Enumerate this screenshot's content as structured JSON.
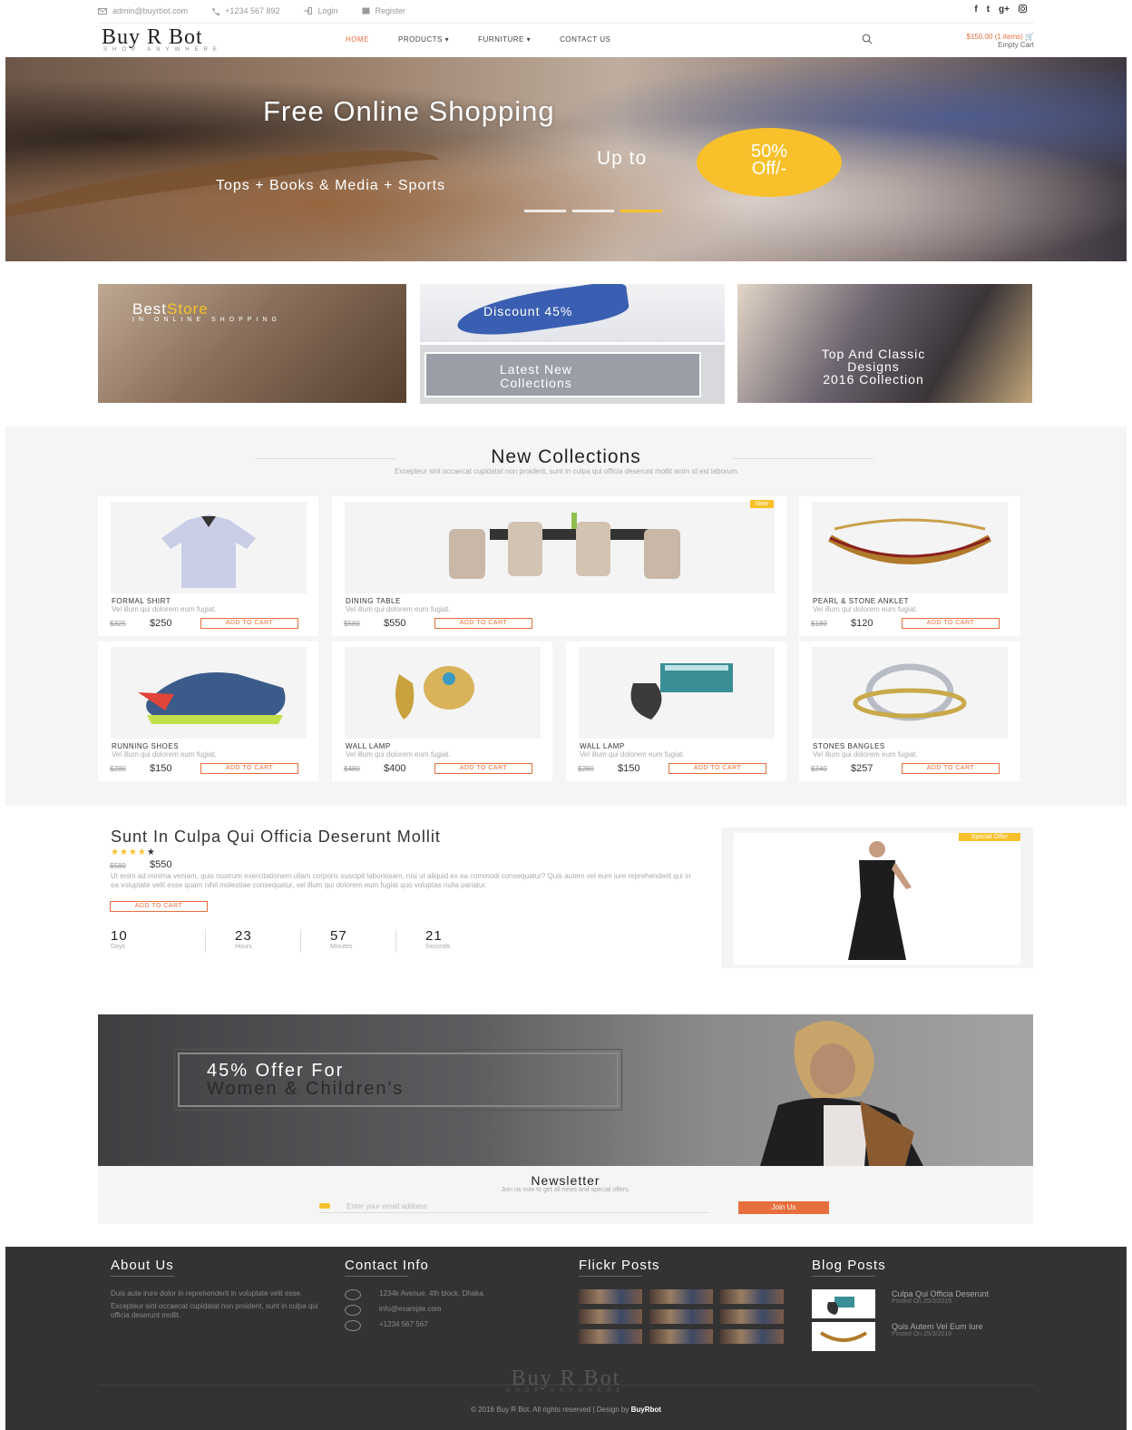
{
  "topbar": {
    "email": "admin@buyrbot.com",
    "phone": "+1234 567 892",
    "login": "Login",
    "register": "Register",
    "social": [
      "f",
      "t",
      "g+",
      "ig"
    ]
  },
  "header": {
    "logo_name": "Buy R Bot",
    "logo_tagline": "SHOP ANYWHERE",
    "nav": [
      "HOME",
      "PRODUCTS",
      "FURNITURE",
      "CONTACT US"
    ],
    "cart_total": "$150.00 (1 items)",
    "cart_sub": "Empty Cart"
  },
  "hero": {
    "title": "Free Online Shopping",
    "up_to": "Up to",
    "badge_line1": "50%",
    "badge_line2": "Off/-",
    "categories": "Tops + Books & Media + Sports"
  },
  "promos": {
    "best_a": "Best",
    "best_b": "Store",
    "best_sub": "IN ONLINE SHOPPING",
    "discount": "Discount 45%",
    "latest_1": "Latest New",
    "latest_2": "Collections",
    "classic_1": "Top And Classic",
    "classic_2": "Designs",
    "classic_3": "2016 Collection"
  },
  "collections": {
    "title": "New Collections",
    "desc": "Excepteur sint occaecat cupidatat non proident, sunt in culpa qui officia deserunt mollit anim id est laborum.",
    "new_tag": "New",
    "add_label": "ADD TO CART",
    "item_desc": "Vel illum qui dolorem eum fugiat.",
    "items": [
      {
        "name": "FORMAL SHIRT",
        "old": "$325",
        "price": "$250"
      },
      {
        "name": "DINING TABLE",
        "old": "$580",
        "price": "$550"
      },
      {
        "name": "PEARL & STONE ANKLET",
        "old": "$180",
        "price": "$120"
      },
      {
        "name": "RUNNING SHOES",
        "old": "$280",
        "price": "$150"
      },
      {
        "name": "WALL LAMP",
        "old": "$480",
        "price": "$400"
      },
      {
        "name": "WALL LAMP",
        "old": "$280",
        "price": "$150"
      },
      {
        "name": "STONES BANGLES",
        "old": "$340",
        "price": "$257"
      }
    ]
  },
  "special": {
    "title": "Sunt In Culpa Qui Officia Deserunt Mollit",
    "rating": 4,
    "old": "$580",
    "price": "$550",
    "desc": "Ut enim ad minima veniam, quis nostrum exercitationem ullam corporis suscipit laboriosam, nisi ut aliquid ex ea commodi consequatur? Quis autem vel eum iure reprehenderit qui in ea voluptate velit esse quam nihil molestiae consequatur, vel illum qui dolorem eum fugiat quo voluptas nulla pariatur.",
    "button": "ADD TO CART",
    "tag": "Special Offer",
    "countdown": [
      {
        "value": "10",
        "label": "Days"
      },
      {
        "value": "23",
        "label": "Hours"
      },
      {
        "value": "57",
        "label": "Minutes"
      },
      {
        "value": "21",
        "label": "Seconds"
      }
    ]
  },
  "banner": {
    "line1": "45% Offer For",
    "line2": "Women & Children's"
  },
  "newsletter": {
    "title": "Newsletter",
    "sub": "Join us now to get all news and special offers.",
    "placeholder": "Enter your email address",
    "button": "Join Us"
  },
  "footer": {
    "about_title": "About Us",
    "about_p1": "Duis aute irure dolor in reprehenderit in voluptate velit esse.",
    "about_p2": "Excepteur sint occaecat cupidatat non proident, sunt in culpa qui officia deserunt mollit.",
    "contact_title": "Contact Info",
    "address": "1234k Avenue, 4th block, Dhaka.",
    "email": "info@example.com",
    "phone": "+1234 567 567",
    "flickr_title": "Flickr Posts",
    "blog_title": "Blog Posts",
    "blog": [
      {
        "title": "Culpa Qui Officia Deserunt",
        "date": "Posted On 25/3/2016"
      },
      {
        "title": "Quis Autem Vel Eum Iure",
        "date": "Posted On 25/3/2016"
      }
    ],
    "logo_name": "Buy R Bot",
    "logo_tagline": "SHOP ANYWHERE",
    "copyright": "© 2016 Buy R Bot. All rights reserved | Design by",
    "designer": "BuyRbot"
  },
  "colors": {
    "accent": "#e76f3d",
    "yellow": "#f8c12b",
    "footer": "#333333"
  }
}
